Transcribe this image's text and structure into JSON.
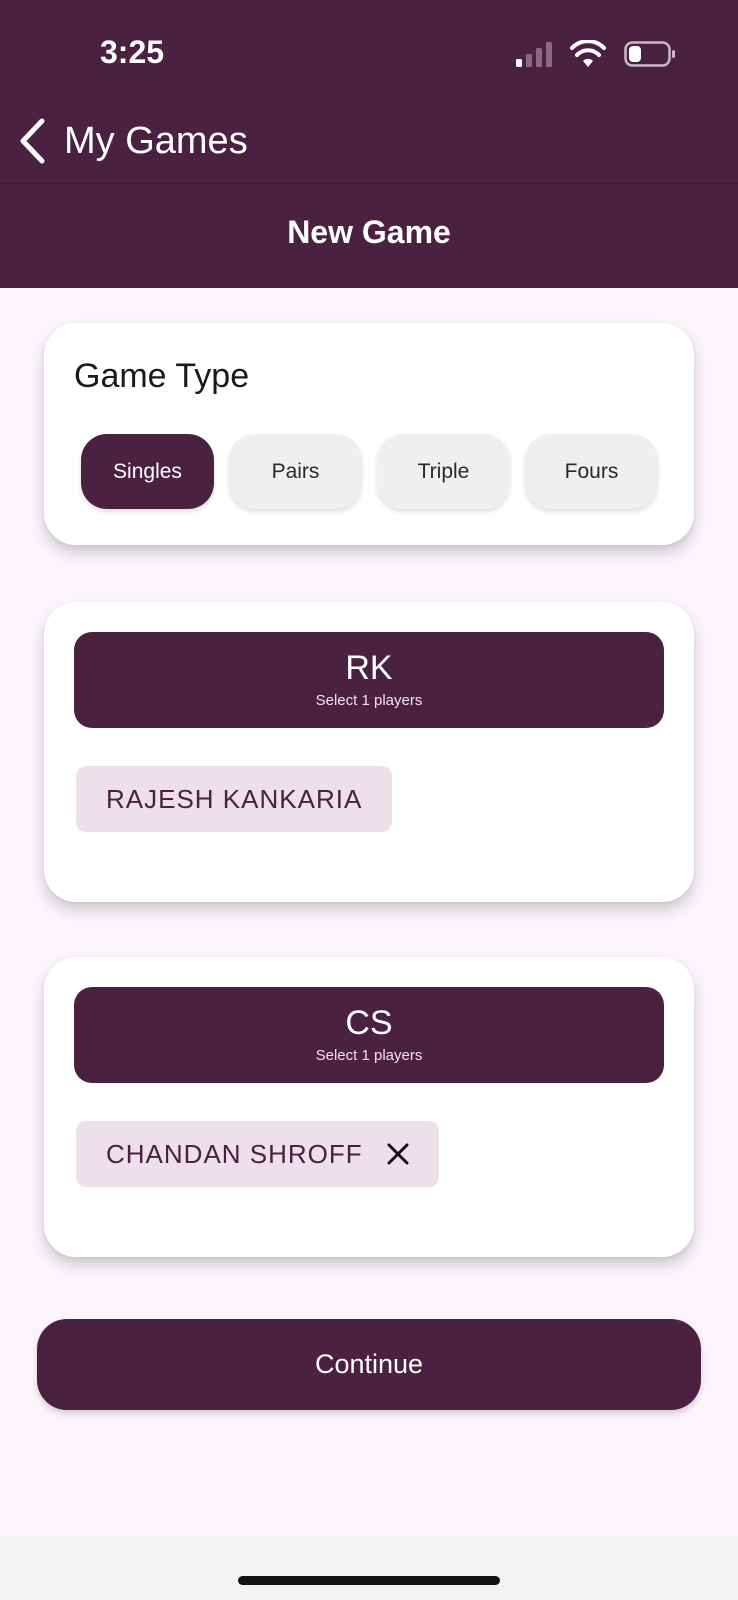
{
  "status_bar": {
    "time": "3:25",
    "icons": [
      "cellular-signal-icon",
      "wifi-icon",
      "battery-icon"
    ]
  },
  "nav": {
    "back_label": "My Games",
    "back_icon": "chevron-left-icon"
  },
  "page": {
    "title": "New Game"
  },
  "game_type": {
    "heading": "Game Type",
    "options": [
      {
        "label": "Singles",
        "selected": true
      },
      {
        "label": "Pairs",
        "selected": false
      },
      {
        "label": "Triple",
        "selected": false
      },
      {
        "label": "Fours",
        "selected": false
      }
    ]
  },
  "teams": [
    {
      "abbr": "RK",
      "subtitle": "Select 1 players",
      "players": [
        {
          "name": "RAJESH KANKARIA",
          "removable": false
        }
      ]
    },
    {
      "abbr": "CS",
      "subtitle": "Select 1 players",
      "players": [
        {
          "name": "CHANDAN SHROFF",
          "removable": true
        }
      ]
    }
  ],
  "actions": {
    "continue_label": "Continue"
  },
  "colors": {
    "brand": "#4a2140",
    "background": "#fcf4fb",
    "chip": "#ede0e8",
    "pill_inactive": "#efefef"
  }
}
